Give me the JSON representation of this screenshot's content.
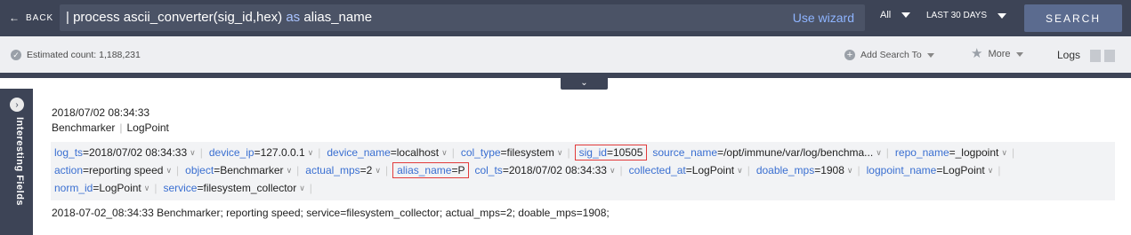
{
  "topbar": {
    "back_label": "BACK",
    "query_prefix": "| process ascii_converter(sig_id,hex) ",
    "query_keyword": "as",
    "query_suffix": " alias_name",
    "use_wizard": "Use wizard",
    "repo_label": "All",
    "time_label": "LAST 30 DAYS",
    "search_label": "SEARCH"
  },
  "subbar": {
    "estimated_count": "Estimated count: 1,188,231",
    "add_search_to": "Add Search To",
    "more": "More",
    "logs": "Logs"
  },
  "sidebar": {
    "label": "Interesting Fields"
  },
  "log": {
    "timestamp": "2018/07/02 08:34:33",
    "source_a": "Benchmarker",
    "source_b": "LogPoint",
    "rows": [
      [
        {
          "key": "log_ts",
          "value": "=2018/07/02 08:34:33",
          "hl": false
        },
        {
          "key": "device_ip",
          "value": "=127.0.0.1",
          "hl": false
        },
        {
          "key": "device_name",
          "value": "=localhost",
          "hl": false
        },
        {
          "key": "col_type",
          "value": "=filesystem",
          "hl": false
        },
        {
          "key": "sig_id",
          "value": "=10505",
          "hl": true
        },
        {
          "key": "source_name",
          "value": "=/opt/immune/var/log/benchma...",
          "hl": false
        },
        {
          "key": "repo_name",
          "value": "=_logpoint",
          "hl": false
        }
      ],
      [
        {
          "key": "action",
          "value": "=reporting speed",
          "hl": false
        },
        {
          "key": "object",
          "value": "=Benchmarker",
          "hl": false
        },
        {
          "key": "actual_mps",
          "value": "=2",
          "hl": false
        },
        {
          "key": "alias_name",
          "value": "=P",
          "hl": true
        },
        {
          "key": "col_ts",
          "value": "=2018/07/02 08:34:33",
          "hl": false
        },
        {
          "key": "collected_at",
          "value": "=LogPoint",
          "hl": false
        },
        {
          "key": "doable_mps",
          "value": "=1908",
          "hl": false
        },
        {
          "key": "logpoint_name",
          "value": "=LogPoint",
          "hl": false
        }
      ],
      [
        {
          "key": "norm_id",
          "value": "=LogPoint",
          "hl": false
        },
        {
          "key": "service",
          "value": "=filesystem_collector",
          "hl": false
        }
      ]
    ],
    "raw": "2018-07-02_08:34:33 Benchmarker; reporting speed; service=filesystem_collector; actual_mps=2; doable_mps=1908;"
  }
}
